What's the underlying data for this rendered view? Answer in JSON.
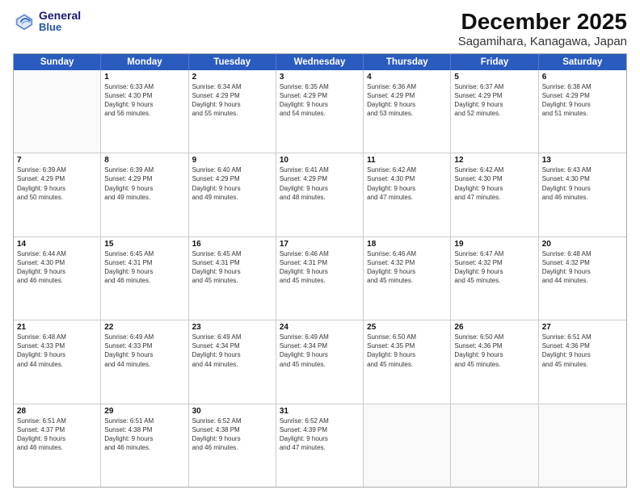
{
  "header": {
    "logo_line1": "General",
    "logo_line2": "Blue",
    "title": "December 2025",
    "subtitle": "Sagamihara, Kanagawa, Japan"
  },
  "calendar": {
    "weekdays": [
      "Sunday",
      "Monday",
      "Tuesday",
      "Wednesday",
      "Thursday",
      "Friday",
      "Saturday"
    ],
    "rows": [
      [
        {
          "day": "",
          "empty": true,
          "info": ""
        },
        {
          "day": "1",
          "info": "Sunrise: 6:33 AM\nSunset: 4:30 PM\nDaylight: 9 hours\nand 56 minutes."
        },
        {
          "day": "2",
          "info": "Sunrise: 6:34 AM\nSunset: 4:29 PM\nDaylight: 9 hours\nand 55 minutes."
        },
        {
          "day": "3",
          "info": "Sunrise: 6:35 AM\nSunset: 4:29 PM\nDaylight: 9 hours\nand 54 minutes."
        },
        {
          "day": "4",
          "info": "Sunrise: 6:36 AM\nSunset: 4:29 PM\nDaylight: 9 hours\nand 53 minutes."
        },
        {
          "day": "5",
          "info": "Sunrise: 6:37 AM\nSunset: 4:29 PM\nDaylight: 9 hours\nand 52 minutes."
        },
        {
          "day": "6",
          "info": "Sunrise: 6:38 AM\nSunset: 4:29 PM\nDaylight: 9 hours\nand 51 minutes."
        }
      ],
      [
        {
          "day": "7",
          "info": "Sunrise: 6:39 AM\nSunset: 4:29 PM\nDaylight: 9 hours\nand 50 minutes."
        },
        {
          "day": "8",
          "info": "Sunrise: 6:39 AM\nSunset: 4:29 PM\nDaylight: 9 hours\nand 49 minutes."
        },
        {
          "day": "9",
          "info": "Sunrise: 6:40 AM\nSunset: 4:29 PM\nDaylight: 9 hours\nand 49 minutes."
        },
        {
          "day": "10",
          "info": "Sunrise: 6:41 AM\nSunset: 4:29 PM\nDaylight: 9 hours\nand 48 minutes."
        },
        {
          "day": "11",
          "info": "Sunrise: 6:42 AM\nSunset: 4:30 PM\nDaylight: 9 hours\nand 47 minutes."
        },
        {
          "day": "12",
          "info": "Sunrise: 6:42 AM\nSunset: 4:30 PM\nDaylight: 9 hours\nand 47 minutes."
        },
        {
          "day": "13",
          "info": "Sunrise: 6:43 AM\nSunset: 4:30 PM\nDaylight: 9 hours\nand 46 minutes."
        }
      ],
      [
        {
          "day": "14",
          "info": "Sunrise: 6:44 AM\nSunset: 4:30 PM\nDaylight: 9 hours\nand 46 minutes."
        },
        {
          "day": "15",
          "info": "Sunrise: 6:45 AM\nSunset: 4:31 PM\nDaylight: 9 hours\nand 46 minutes."
        },
        {
          "day": "16",
          "info": "Sunrise: 6:45 AM\nSunset: 4:31 PM\nDaylight: 9 hours\nand 45 minutes."
        },
        {
          "day": "17",
          "info": "Sunrise: 6:46 AM\nSunset: 4:31 PM\nDaylight: 9 hours\nand 45 minutes."
        },
        {
          "day": "18",
          "info": "Sunrise: 6:46 AM\nSunset: 4:32 PM\nDaylight: 9 hours\nand 45 minutes."
        },
        {
          "day": "19",
          "info": "Sunrise: 6:47 AM\nSunset: 4:32 PM\nDaylight: 9 hours\nand 45 minutes."
        },
        {
          "day": "20",
          "info": "Sunrise: 6:48 AM\nSunset: 4:32 PM\nDaylight: 9 hours\nand 44 minutes."
        }
      ],
      [
        {
          "day": "21",
          "info": "Sunrise: 6:48 AM\nSunset: 4:33 PM\nDaylight: 9 hours\nand 44 minutes."
        },
        {
          "day": "22",
          "info": "Sunrise: 6:49 AM\nSunset: 4:33 PM\nDaylight: 9 hours\nand 44 minutes."
        },
        {
          "day": "23",
          "info": "Sunrise: 6:49 AM\nSunset: 4:34 PM\nDaylight: 9 hours\nand 44 minutes."
        },
        {
          "day": "24",
          "info": "Sunrise: 6:49 AM\nSunset: 4:34 PM\nDaylight: 9 hours\nand 45 minutes."
        },
        {
          "day": "25",
          "info": "Sunrise: 6:50 AM\nSunset: 4:35 PM\nDaylight: 9 hours\nand 45 minutes."
        },
        {
          "day": "26",
          "info": "Sunrise: 6:50 AM\nSunset: 4:36 PM\nDaylight: 9 hours\nand 45 minutes."
        },
        {
          "day": "27",
          "info": "Sunrise: 6:51 AM\nSunset: 4:36 PM\nDaylight: 9 hours\nand 45 minutes."
        }
      ],
      [
        {
          "day": "28",
          "info": "Sunrise: 6:51 AM\nSunset: 4:37 PM\nDaylight: 9 hours\nand 46 minutes."
        },
        {
          "day": "29",
          "info": "Sunrise: 6:51 AM\nSunset: 4:38 PM\nDaylight: 9 hours\nand 46 minutes."
        },
        {
          "day": "30",
          "info": "Sunrise: 6:52 AM\nSunset: 4:38 PM\nDaylight: 9 hours\nand 46 minutes."
        },
        {
          "day": "31",
          "info": "Sunrise: 6:52 AM\nSunset: 4:39 PM\nDaylight: 9 hours\nand 47 minutes."
        },
        {
          "day": "",
          "empty": true,
          "info": ""
        },
        {
          "day": "",
          "empty": true,
          "info": ""
        },
        {
          "day": "",
          "empty": true,
          "info": ""
        }
      ]
    ]
  }
}
